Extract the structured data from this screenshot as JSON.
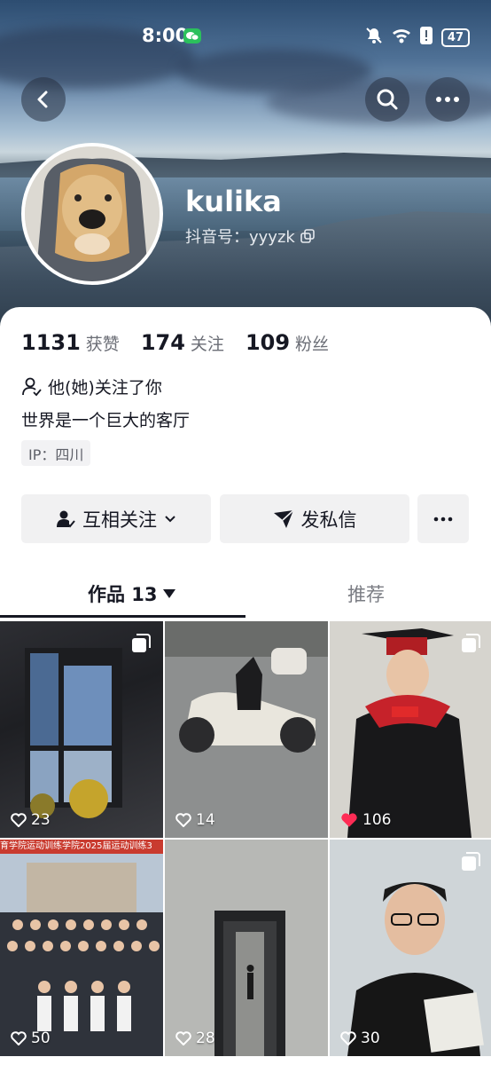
{
  "status_bar": {
    "time": "8:00",
    "battery": "47"
  },
  "profile": {
    "nickname": "kulika",
    "douyin_id": "抖音号：yyyzk"
  },
  "stats": [
    {
      "value": "1131",
      "label": "获赞"
    },
    {
      "value": "174",
      "label": "关注"
    },
    {
      "value": "109",
      "label": "粉丝"
    }
  ],
  "follow_note": "他(她)关注了你",
  "bio": "世界是一个巨大的客厅",
  "ip": "IP：四川",
  "actions": {
    "mutual_follow": "互相关注",
    "send_message": "发私信"
  },
  "tabs": {
    "works": "作品 13",
    "recommend": "推荐"
  },
  "posts": [
    {
      "likes": "23",
      "multi": true,
      "liked": false
    },
    {
      "likes": "14",
      "multi": false,
      "liked": false
    },
    {
      "likes": "106",
      "multi": true,
      "liked": true
    },
    {
      "likes": "50",
      "multi": false,
      "liked": false,
      "banner": "育学院运动训练学院2025届运动训练3"
    },
    {
      "likes": "28",
      "multi": false,
      "liked": false
    },
    {
      "likes": "30",
      "multi": true,
      "liked": false
    }
  ],
  "colors": {
    "like_red": "#fe2c55",
    "button_bg": "#f1f1f2",
    "text_primary": "#161823"
  }
}
